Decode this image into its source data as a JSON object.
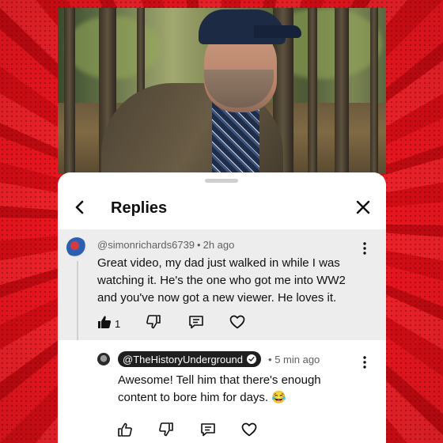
{
  "header": {
    "title": "Replies"
  },
  "parent_comment": {
    "author": "@simonrichards6739",
    "time": "2h ago",
    "text": "Great video, my dad just walked in while I was watching it. He's the one who got me into WW2 and you've now got a new viewer. He loves it.",
    "like_count": "1"
  },
  "reply_comment": {
    "author": "@TheHistoryUnderground",
    "time": "5 min ago",
    "text": "Awesome! Tell him that there's enough content to bore him for days. 😂"
  },
  "colors": {
    "background": "#e8101a",
    "panel": "#ffffff",
    "parent_bg": "#ededed",
    "chip": "#1f1f1f"
  },
  "icons": [
    "back-arrow-icon",
    "close-icon",
    "more-icon",
    "thumbs-up-filled-icon",
    "thumbs-up-icon",
    "thumbs-down-icon",
    "reply-icon",
    "heart-icon",
    "verified-icon"
  ]
}
